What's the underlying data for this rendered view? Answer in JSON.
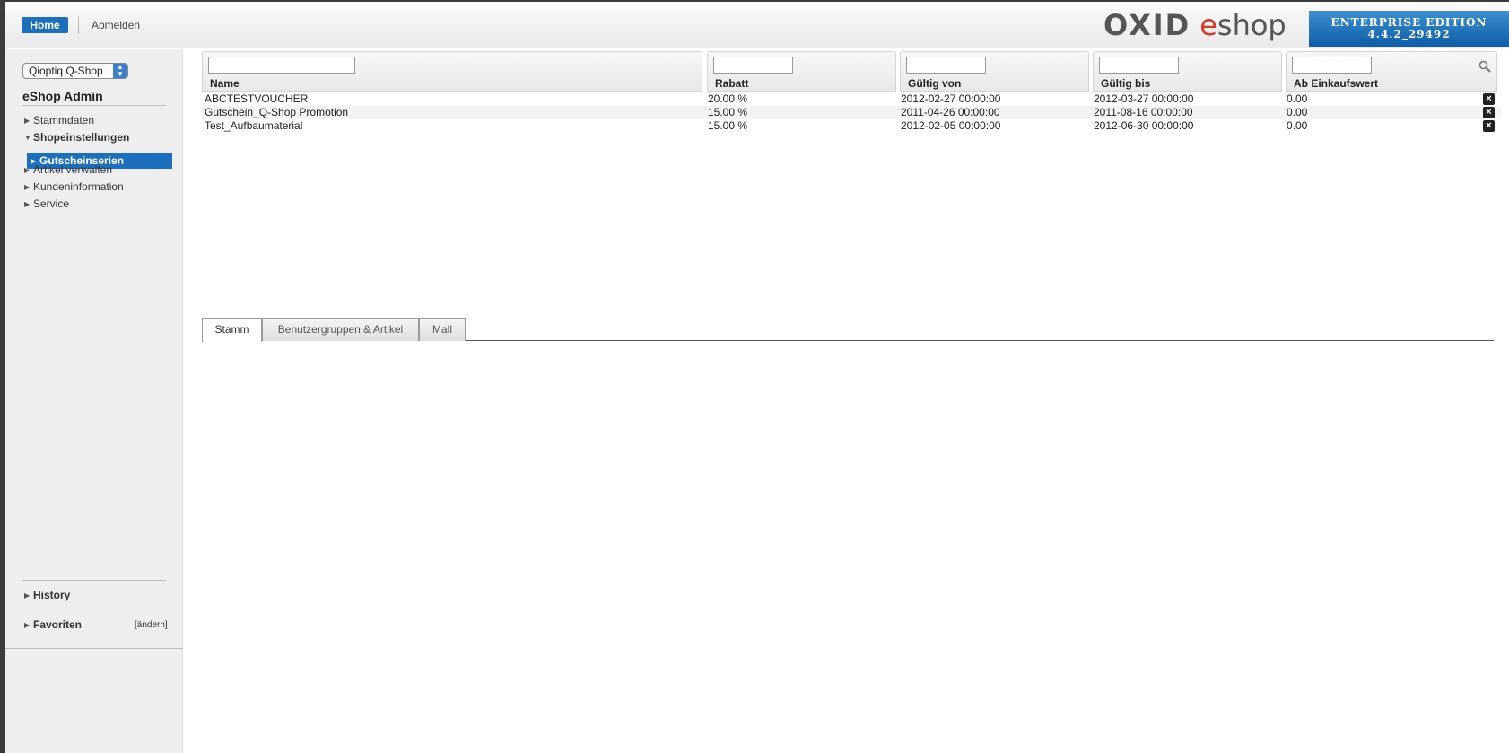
{
  "header": {
    "home_label": "Home",
    "logout_label": "Abmelden",
    "logo_part1": "OXID",
    "logo_part2": "e",
    "logo_part3": "shop",
    "edition_line1": "ENTERPRISE EDITION",
    "edition_line2": "4.4.2_29492"
  },
  "sidebar": {
    "shop_selected": "Qioptiq Q-Shop",
    "title": "eShop Admin",
    "items": [
      {
        "label": "Stammdaten"
      },
      {
        "label": "Shopeinstellungen"
      },
      {
        "label": "Gutscheinserien"
      },
      {
        "label": "Artikel verwalten"
      },
      {
        "label": "Kundeninformation"
      },
      {
        "label": "Service"
      }
    ],
    "history_label": "History",
    "favorites_label": "Favoriten",
    "favorites_edit": "[ändern]"
  },
  "list": {
    "columns": [
      "Name",
      "Rabatt",
      "Gültig von",
      "Gültig bis",
      "Ab Einkaufswert"
    ],
    "rows": [
      {
        "name": "ABCTESTVOUCHER",
        "rabatt": "20.00 %",
        "von": "2012-02-27 00:00:00",
        "bis": "2012-03-27 00:00:00",
        "wert": "0.00"
      },
      {
        "name": "Gutschein_Q-Shop Promotion",
        "rabatt": "15.00 %",
        "von": "2011-04-26 00:00:00",
        "bis": "2011-08-16 00:00:00",
        "wert": "0.00"
      },
      {
        "name": "Test_Aufbaumaterial",
        "rabatt": "15.00 %",
        "von": "2012-02-05 00:00:00",
        "bis": "2012-06-30 00:00:00",
        "wert": "0.00"
      }
    ]
  },
  "tabs": [
    {
      "label": "Stamm"
    },
    {
      "label": "Benutzergruppen & Artikel"
    },
    {
      "label": "Mall"
    }
  ],
  "colors": {
    "accent": "#1c6fbf",
    "logo_red": "#d9362a"
  }
}
